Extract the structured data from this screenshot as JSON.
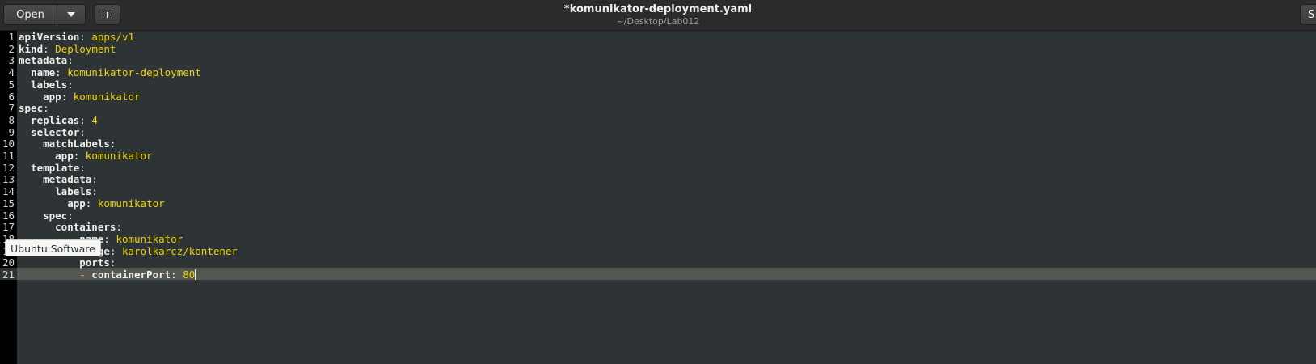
{
  "toolbar": {
    "open_label": "Open",
    "open_menu_icon": "triangle-down-icon",
    "new_tab_icon": "new-document-icon",
    "right_label": "S"
  },
  "document": {
    "title": "*komunikator-deployment.yaml",
    "path": "~/Desktop/Lab012"
  },
  "tooltip": {
    "text": "Ubuntu Software"
  },
  "editor": {
    "current_line": 21,
    "lines": [
      {
        "n": "1",
        "indent": "",
        "key": "apiVersion",
        "value": "apps/v1"
      },
      {
        "n": "2",
        "indent": "",
        "key": "kind",
        "value": "Deployment"
      },
      {
        "n": "3",
        "indent": "",
        "key": "metadata",
        "value": ""
      },
      {
        "n": "4",
        "indent": "  ",
        "key": "name",
        "value": "komunikator-deployment"
      },
      {
        "n": "5",
        "indent": "  ",
        "key": "labels",
        "value": ""
      },
      {
        "n": "6",
        "indent": "    ",
        "key": "app",
        "value": "komunikator"
      },
      {
        "n": "7",
        "indent": "",
        "key": "spec",
        "value": ""
      },
      {
        "n": "8",
        "indent": "  ",
        "key": "replicas",
        "value": "4"
      },
      {
        "n": "9",
        "indent": "  ",
        "key": "selector",
        "value": ""
      },
      {
        "n": "10",
        "indent": "    ",
        "key": "matchLabels",
        "value": ""
      },
      {
        "n": "11",
        "indent": "      ",
        "key": "app",
        "value": "komunikator"
      },
      {
        "n": "12",
        "indent": "  ",
        "key": "template",
        "value": ""
      },
      {
        "n": "13",
        "indent": "    ",
        "key": "metadata",
        "value": ""
      },
      {
        "n": "14",
        "indent": "      ",
        "key": "labels",
        "value": ""
      },
      {
        "n": "15",
        "indent": "        ",
        "key": "app",
        "value": "komunikator"
      },
      {
        "n": "16",
        "indent": "    ",
        "key": "spec",
        "value": ""
      },
      {
        "n": "17",
        "indent": "      ",
        "key": "containers",
        "value": ""
      },
      {
        "n": "18",
        "indent": "        ",
        "dash": "- ",
        "key": "name",
        "value": "komunikator"
      },
      {
        "n": "19",
        "indent": "          ",
        "key": "image",
        "value": "karolkarcz/kontener"
      },
      {
        "n": "20",
        "indent": "          ",
        "key": "ports",
        "value": ""
      },
      {
        "n": "21",
        "indent": "          ",
        "dash": "- ",
        "key": "containerPort",
        "value": "80"
      }
    ]
  },
  "colors": {
    "editor_background": "#2e3436",
    "gutter_background": "#000000",
    "key": "#eeeeec",
    "value": "#edd400",
    "current_line": "#555753"
  }
}
